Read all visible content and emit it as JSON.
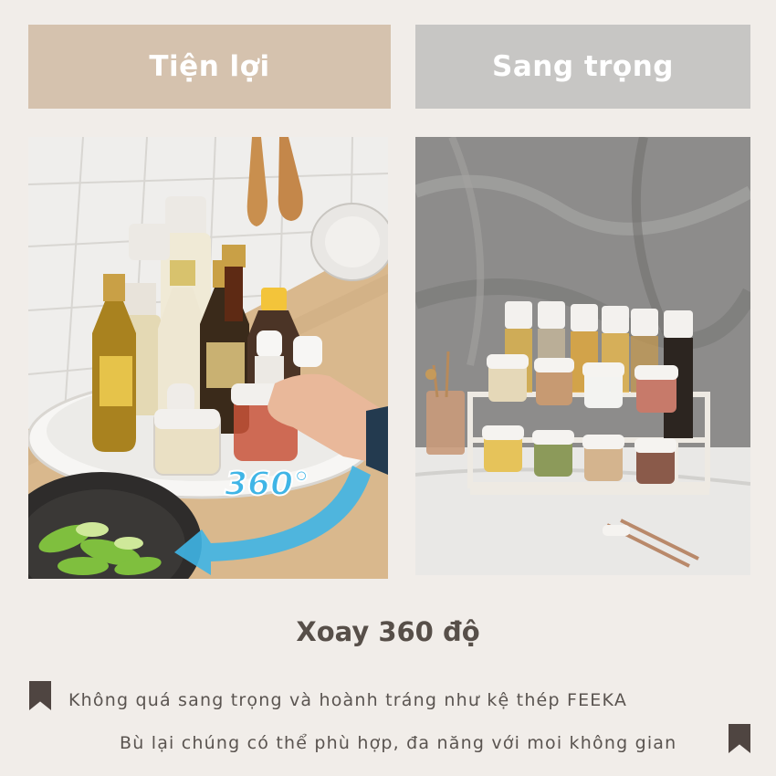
{
  "header": {
    "left_label": "Tiện lợi",
    "right_label": "Sang trọng"
  },
  "photos": {
    "left": {
      "overlay_text": "360°",
      "icon": "rotate-arrow-icon"
    },
    "right": {}
  },
  "caption": {
    "title": "Xoay 360 độ",
    "line_1": "Không quá sang trọng và hoành tráng như kệ thép FEEKA",
    "line_2": "Bù lại chúng có thể phù hợp, đa năng với moi không gian",
    "bookmark_icon": "bookmark-icon"
  },
  "colors": {
    "background": "#f1ede9",
    "left_box": "#d5c2ae",
    "right_box": "#c7c6c4",
    "text_dark": "#574f49",
    "accent_blue": "#3fb5e6"
  }
}
